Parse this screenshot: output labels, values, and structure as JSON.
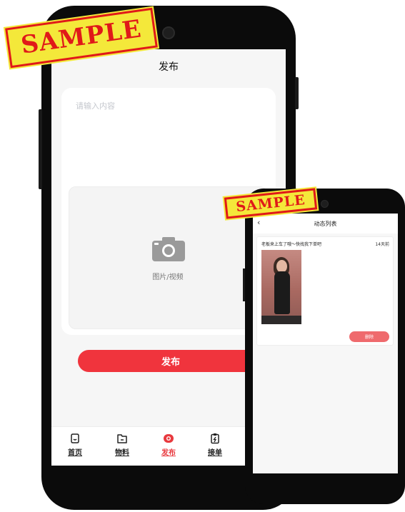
{
  "publish_screen": {
    "title": "发布",
    "content_placeholder": "请输入内容",
    "media_label": "图片/视频",
    "publish_button": "发布",
    "tabs": [
      {
        "label": "首页",
        "icon": "home-icon",
        "active": false
      },
      {
        "label": "物料",
        "icon": "folder-icon",
        "active": false
      },
      {
        "label": "发布",
        "icon": "publish-icon",
        "active": true
      },
      {
        "label": "接单",
        "icon": "order-icon",
        "active": false
      }
    ]
  },
  "feed_screen": {
    "title": "动态列表",
    "back_icon": "back-chevron-icon",
    "posts": [
      {
        "text": "老板来上车了哦～快找我下单吧",
        "time": "14天前",
        "delete_label": "删除"
      }
    ]
  },
  "watermarks": [
    "SAMPLE",
    "SAMPLE"
  ],
  "colors": {
    "accent": "#f0343d",
    "delete": "#ef6a6d",
    "stamp_fill": "#f4e83a",
    "stamp_text": "#e01919"
  }
}
